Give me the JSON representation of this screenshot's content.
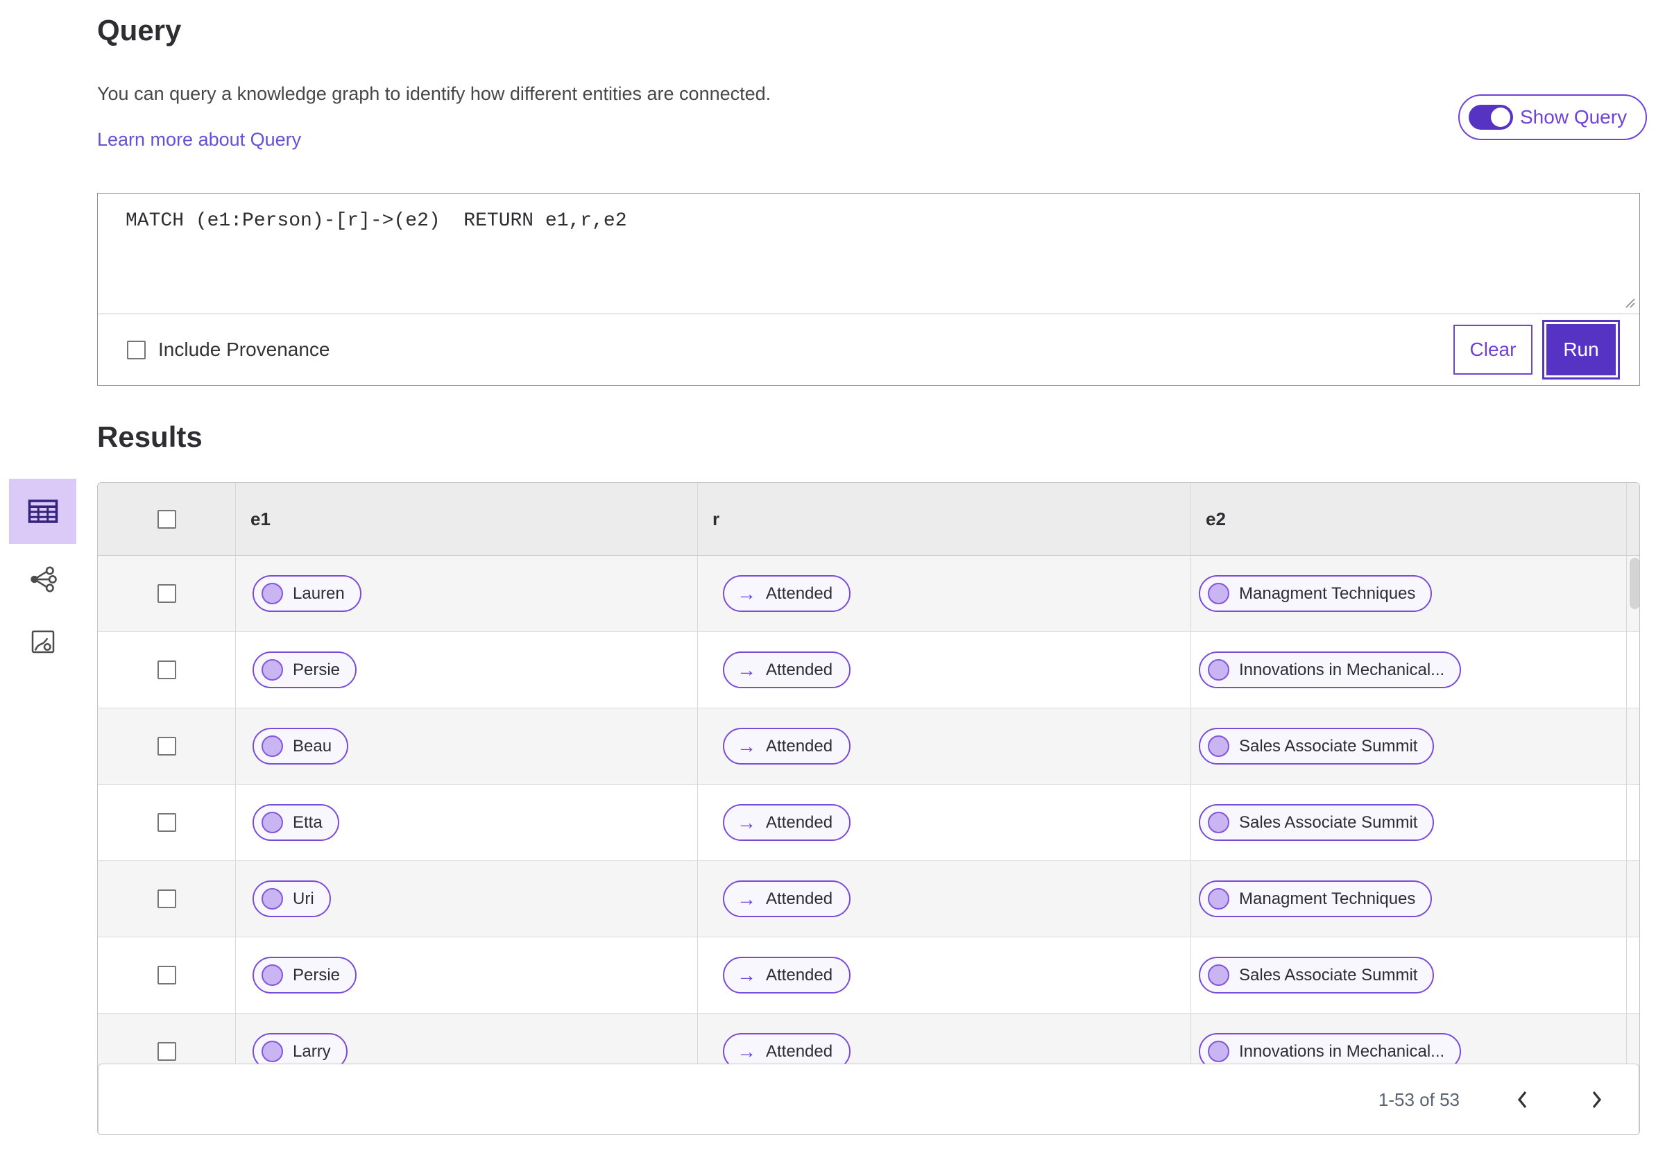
{
  "page": {
    "title": "Query",
    "description": "You can query a knowledge graph to identify how different entities are connected.",
    "learn_more_label": "Learn more about Query",
    "show_query_label": "Show Query",
    "show_query_on": true
  },
  "query_editor": {
    "text": "MATCH (e1:Person)-[r]->(e2)  RETURN e1,r,e2",
    "include_provenance_label": "Include Provenance",
    "include_provenance_checked": false,
    "clear_label": "Clear",
    "run_label": "Run"
  },
  "results": {
    "title": "Results",
    "columns": [
      "e1",
      "r",
      "e2"
    ],
    "rows": [
      {
        "e1": "Lauren",
        "r": "Attended",
        "e2": "Managment Techniques"
      },
      {
        "e1": "Persie",
        "r": "Attended",
        "e2": "Innovations in Mechanical..."
      },
      {
        "e1": "Beau",
        "r": "Attended",
        "e2": "Sales Associate Summit"
      },
      {
        "e1": "Etta",
        "r": "Attended",
        "e2": "Sales Associate Summit"
      },
      {
        "e1": "Uri",
        "r": "Attended",
        "e2": "Managment Techniques"
      },
      {
        "e1": "Persie",
        "r": "Attended",
        "e2": "Sales Associate Summit"
      },
      {
        "e1": "Larry",
        "r": "Attended",
        "e2": "Innovations in Mechanical..."
      }
    ],
    "pagination": {
      "range_label": "1-53 of 53"
    },
    "view_switcher": {
      "active_view": "table",
      "views": [
        "table",
        "graph",
        "chart"
      ]
    }
  },
  "icons": {
    "arrow_right": "→"
  },
  "colors": {
    "accent_purple": "#6f42d8",
    "deep_purple": "#5733c4",
    "pill_border": "#7a4bd9",
    "pill_background": "#f9f7fe",
    "node_fill": "#c9b5f1",
    "active_tile_background": "#dbc9f8",
    "link": "#6152d9",
    "header_row_background": "#ececec",
    "stripe_row_background": "#f5f5f5"
  }
}
